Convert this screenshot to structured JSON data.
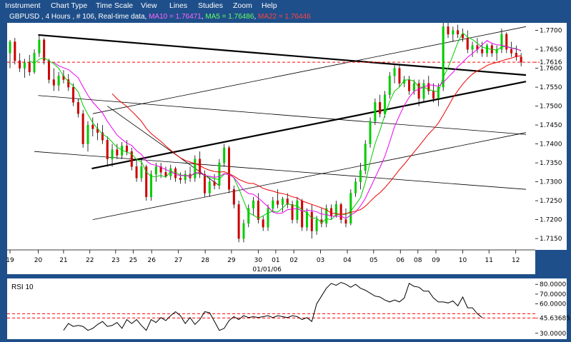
{
  "menu": [
    {
      "id": "instrument",
      "label": "Instrument"
    },
    {
      "id": "chart-type",
      "label": "Chart Type"
    },
    {
      "id": "time-scale",
      "label": "Time Scale"
    },
    {
      "id": "view",
      "label": "View"
    },
    {
      "id": "lines",
      "label": "Lines"
    },
    {
      "id": "studies",
      "label": "Studies"
    },
    {
      "id": "zoom",
      "label": "Zoom"
    },
    {
      "id": "help",
      "label": "Help"
    }
  ],
  "header": {
    "symbol_text": "GBPUSD , 4 Hours , # 106, Real-time data",
    "sep1": ", ",
    "ma10_text": "MA10 = 1.76471",
    "sep2": ", ",
    "ma5_text": "MA5 = 1.76486",
    "sep3": ", ",
    "ma22_text": "MA22 = 1.76446"
  },
  "colors": {
    "background": "#ffffff",
    "frame": "#1f4f8a",
    "up_candle": "#00cc00",
    "down_candle": "#cc0000",
    "ma5": "#00cc00",
    "ma10": "#ee00ee",
    "ma22": "#ee0000",
    "level_line": "#ff0000",
    "rsi_line": "#000000",
    "grid": "#999999"
  },
  "chart_data": [
    {
      "type": "candlestick",
      "title": "GBPUSD , 4 Hours , # 106, Real-time data",
      "price_axis": {
        "ylim": [
          1.712,
          1.772
        ],
        "ticks": [
          "1.7700",
          "1.7650",
          "1.7600",
          "1.7550",
          "1.7500",
          "1.7450",
          "1.7400",
          "1.7350",
          "1.7300",
          "1.7250",
          "1.7200",
          "1.7150"
        ],
        "current_price_label": "1.7616",
        "current_price": 1.7616
      },
      "time_axis": {
        "xlim": [
          0,
          106
        ],
        "ticks": [
          {
            "x": 0,
            "label": "19"
          },
          {
            "x": 5.8,
            "label": "20"
          },
          {
            "x": 11,
            "label": "21"
          },
          {
            "x": 16.4,
            "label": "22"
          },
          {
            "x": 21.7,
            "label": "23"
          },
          {
            "x": 25.3,
            "label": "25"
          },
          {
            "x": 29.1,
            "label": "26"
          },
          {
            "x": 34.6,
            "label": "27"
          },
          {
            "x": 40.1,
            "label": "28"
          },
          {
            "x": 45.5,
            "label": "29"
          },
          {
            "x": 51,
            "label": "30"
          },
          {
            "x": 54.6,
            "label": "01"
          },
          {
            "x": 58.3,
            "label": "02"
          },
          {
            "x": 63.8,
            "label": "03"
          },
          {
            "x": 69.3,
            "label": "04"
          },
          {
            "x": 74.7,
            "label": "05"
          },
          {
            "x": 80.2,
            "label": "06"
          },
          {
            "x": 83.8,
            "label": "08"
          },
          {
            "x": 87.5,
            "label": "09"
          },
          {
            "x": 93,
            "label": "10"
          },
          {
            "x": 98.4,
            "label": "11"
          },
          {
            "x": 103.9,
            "label": "12"
          }
        ],
        "sublabel": "01/01/06",
        "sublabel_x": 52.8
      },
      "candles": [
        [
          1.764,
          1.7675,
          1.76,
          1.767
        ],
        [
          1.767,
          1.768,
          1.761,
          1.762
        ],
        [
          1.762,
          1.764,
          1.759,
          1.76
        ],
        [
          1.76,
          1.7625,
          1.7575,
          1.7615
        ],
        [
          1.7615,
          1.7635,
          1.758,
          1.759
        ],
        [
          1.759,
          1.765,
          1.7585,
          1.764
        ],
        [
          1.764,
          1.769,
          1.763,
          1.7675
        ],
        [
          1.7675,
          1.768,
          1.761,
          1.762
        ],
        [
          1.762,
          1.7625,
          1.756,
          1.757
        ],
        [
          1.757,
          1.76,
          1.754,
          1.7555
        ],
        [
          1.7555,
          1.759,
          1.754,
          1.758
        ],
        [
          1.758,
          1.7595,
          1.756,
          1.757
        ],
        [
          1.757,
          1.7585,
          1.754,
          1.755
        ],
        [
          1.755,
          1.756,
          1.75,
          1.751
        ],
        [
          1.751,
          1.752,
          1.747,
          1.748
        ],
        [
          1.748,
          1.749,
          1.739,
          1.74
        ],
        [
          1.74,
          1.746,
          1.738,
          1.745
        ],
        [
          1.745,
          1.747,
          1.742,
          1.744
        ],
        [
          1.744,
          1.7455,
          1.741,
          1.743
        ],
        [
          1.743,
          1.745,
          1.74,
          1.741
        ],
        [
          1.741,
          1.742,
          1.734,
          1.736
        ],
        [
          1.736,
          1.74,
          1.734,
          1.7385
        ],
        [
          1.7385,
          1.74,
          1.736,
          1.737
        ],
        [
          1.737,
          1.7405,
          1.736,
          1.7395
        ],
        [
          1.7395,
          1.741,
          1.737,
          1.738
        ],
        [
          1.738,
          1.739,
          1.733,
          1.734
        ],
        [
          1.734,
          1.736,
          1.73,
          1.731
        ],
        [
          1.731,
          1.736,
          1.73,
          1.734
        ],
        [
          1.734,
          1.7345,
          1.725,
          1.726
        ],
        [
          1.726,
          1.733,
          1.725,
          1.732
        ],
        [
          1.732,
          1.735,
          1.73,
          1.734
        ],
        [
          1.734,
          1.735,
          1.731,
          1.7325
        ],
        [
          1.7325,
          1.734,
          1.731,
          1.7315
        ],
        [
          1.7315,
          1.7345,
          1.7305,
          1.7335
        ],
        [
          1.7335,
          1.734,
          1.73,
          1.731
        ],
        [
          1.731,
          1.7325,
          1.7295,
          1.7305
        ],
        [
          1.7305,
          1.733,
          1.7295,
          1.732
        ],
        [
          1.732,
          1.734,
          1.73,
          1.731
        ],
        [
          1.731,
          1.737,
          1.73,
          1.736
        ],
        [
          1.736,
          1.738,
          1.731,
          1.732
        ],
        [
          1.732,
          1.733,
          1.726,
          1.727
        ],
        [
          1.727,
          1.731,
          1.726,
          1.73
        ],
        [
          1.73,
          1.732,
          1.728,
          1.729
        ],
        [
          1.729,
          1.736,
          1.728,
          1.735
        ],
        [
          1.735,
          1.74,
          1.734,
          1.739
        ],
        [
          1.739,
          1.7395,
          1.727,
          1.728
        ],
        [
          1.728,
          1.729,
          1.723,
          1.724
        ],
        [
          1.724,
          1.725,
          1.714,
          1.715
        ],
        [
          1.715,
          1.72,
          1.714,
          1.719
        ],
        [
          1.719,
          1.724,
          1.718,
          1.723
        ],
        [
          1.723,
          1.726,
          1.721,
          1.725
        ],
        [
          1.725,
          1.727,
          1.719,
          1.72
        ],
        [
          1.72,
          1.721,
          1.717,
          1.718
        ],
        [
          1.718,
          1.724,
          1.717,
          1.723
        ],
        [
          1.723,
          1.726,
          1.722,
          1.725
        ],
        [
          1.725,
          1.728,
          1.723,
          1.724
        ],
        [
          1.724,
          1.726,
          1.722,
          1.7255
        ],
        [
          1.7255,
          1.727,
          1.723,
          1.724
        ],
        [
          1.724,
          1.725,
          1.719,
          1.72
        ],
        [
          1.72,
          1.726,
          1.719,
          1.725
        ],
        [
          1.725,
          1.7255,
          1.717,
          1.718
        ],
        [
          1.718,
          1.723,
          1.717,
          1.722
        ],
        [
          1.722,
          1.724,
          1.715,
          1.717
        ],
        [
          1.717,
          1.721,
          1.716,
          1.72
        ],
        [
          1.72,
          1.723,
          1.718,
          1.719
        ],
        [
          1.719,
          1.724,
          1.718,
          1.723
        ],
        [
          1.723,
          1.724,
          1.72,
          1.721
        ],
        [
          1.721,
          1.725,
          1.7205,
          1.724
        ],
        [
          1.724,
          1.7245,
          1.719,
          1.72
        ],
        [
          1.72,
          1.723,
          1.718,
          1.719
        ],
        [
          1.719,
          1.728,
          1.7185,
          1.727
        ],
        [
          1.727,
          1.731,
          1.726,
          1.73
        ],
        [
          1.73,
          1.735,
          1.728,
          1.733
        ],
        [
          1.733,
          1.741,
          1.732,
          1.74
        ],
        [
          1.74,
          1.747,
          1.739,
          1.746
        ],
        [
          1.746,
          1.752,
          1.745,
          1.751
        ],
        [
          1.751,
          1.753,
          1.747,
          1.748
        ],
        [
          1.748,
          1.754,
          1.747,
          1.753
        ],
        [
          1.753,
          1.759,
          1.752,
          1.758
        ],
        [
          1.758,
          1.761,
          1.756,
          1.76
        ],
        [
          1.76,
          1.761,
          1.755,
          1.756
        ],
        [
          1.756,
          1.758,
          1.755,
          1.757
        ],
        [
          1.757,
          1.758,
          1.753,
          1.754
        ],
        [
          1.754,
          1.757,
          1.753,
          1.756
        ],
        [
          1.756,
          1.757,
          1.75,
          1.752
        ],
        [
          1.752,
          1.757,
          1.751,
          1.756
        ],
        [
          1.756,
          1.758,
          1.753,
          1.754
        ],
        [
          1.754,
          1.756,
          1.751,
          1.752
        ],
        [
          1.752,
          1.756,
          1.75,
          1.755
        ],
        [
          1.755,
          1.772,
          1.754,
          1.771
        ],
        [
          1.771,
          1.772,
          1.768,
          1.769
        ],
        [
          1.769,
          1.771,
          1.767,
          1.77
        ],
        [
          1.77,
          1.7715,
          1.768,
          1.769
        ],
        [
          1.769,
          1.7705,
          1.767,
          1.768
        ],
        [
          1.768,
          1.77,
          1.764,
          1.765
        ],
        [
          1.765,
          1.767,
          1.763,
          1.766
        ],
        [
          1.766,
          1.768,
          1.764,
          1.765
        ],
        [
          1.765,
          1.767,
          1.763,
          1.764
        ],
        [
          1.764,
          1.7665,
          1.763,
          1.766
        ],
        [
          1.766,
          1.7665,
          1.763,
          1.764
        ],
        [
          1.764,
          1.766,
          1.762,
          1.765
        ],
        [
          1.765,
          1.7705,
          1.764,
          1.769
        ],
        [
          1.769,
          1.7695,
          1.764,
          1.765
        ],
        [
          1.765,
          1.767,
          1.763,
          1.764
        ],
        [
          1.764,
          1.766,
          1.762,
          1.763
        ],
        [
          1.763,
          1.764,
          1.7605,
          1.7616
        ]
      ],
      "series": [
        {
          "name": "MA5",
          "color": "#00cc00",
          "period": 5
        },
        {
          "name": "MA10",
          "color": "#ee00ee",
          "period": 10
        },
        {
          "name": "MA22",
          "color": "#ee0000",
          "period": 22
        }
      ],
      "horizontal_levels": [
        1.7616
      ],
      "trendlines": [
        {
          "from": [
            5.8,
            1.7688
          ],
          "to": [
            106,
            1.7582
          ],
          "weight": "thick"
        },
        {
          "from": [
            16.8,
            1.7335
          ],
          "to": [
            106,
            1.7565
          ],
          "weight": "thick"
        },
        {
          "from": [
            17,
            1.748
          ],
          "to": [
            106,
            1.771
          ],
          "weight": "thin"
        },
        {
          "from": [
            5.8,
            1.7528
          ],
          "to": [
            106,
            1.7425
          ],
          "weight": "thin"
        },
        {
          "from": [
            5,
            1.738
          ],
          "to": [
            106,
            1.728
          ],
          "weight": "thin"
        },
        {
          "from": [
            17,
            1.72
          ],
          "to": [
            106,
            1.743
          ],
          "weight": "thin"
        },
        {
          "from": [
            20,
            1.75
          ],
          "to": [
            43,
            1.729
          ],
          "weight": "thin"
        }
      ]
    },
    {
      "type": "line",
      "title": "RSI 10",
      "ylim": [
        24,
        86
      ],
      "ticks": [
        "80.0000",
        "70.0000",
        "60.0000",
        "45.63685",
        "30.0000"
      ],
      "levels": [
        {
          "value": 50,
          "color": "#ff0000",
          "dashed": true
        },
        {
          "value": 45.63685,
          "color": "#ff0000",
          "dashed": true
        }
      ],
      "current_value": 45.63685,
      "values": [
        [
          11,
          33
        ],
        [
          12,
          40
        ],
        [
          13,
          37
        ],
        [
          14,
          38
        ],
        [
          15,
          37
        ],
        [
          16,
          33
        ],
        [
          17,
          35
        ],
        [
          18,
          39
        ],
        [
          19,
          42
        ],
        [
          20,
          37
        ],
        [
          21,
          38
        ],
        [
          22,
          41
        ],
        [
          23,
          35
        ],
        [
          24,
          44
        ],
        [
          25,
          40
        ],
        [
          26,
          44
        ],
        [
          27,
          38
        ],
        [
          28,
          33
        ],
        [
          29,
          44
        ],
        [
          30,
          41
        ],
        [
          31,
          46
        ],
        [
          32,
          43
        ],
        [
          33,
          48
        ],
        [
          34,
          52
        ],
        [
          35,
          48
        ],
        [
          36,
          40
        ],
        [
          37,
          46
        ],
        [
          38,
          39
        ],
        [
          39,
          44
        ],
        [
          40,
          52
        ],
        [
          41,
          51
        ],
        [
          42,
          42
        ],
        [
          43,
          33
        ],
        [
          44,
          35
        ],
        [
          45,
          43
        ],
        [
          46,
          47
        ],
        [
          47,
          44
        ],
        [
          48,
          48
        ],
        [
          49,
          46
        ],
        [
          50,
          47
        ],
        [
          51,
          46
        ],
        [
          52,
          47
        ],
        [
          53,
          48
        ],
        [
          54,
          46
        ],
        [
          55,
          48
        ],
        [
          56,
          47
        ],
        [
          57,
          46
        ],
        [
          58,
          48
        ],
        [
          59,
          47
        ],
        [
          60,
          44
        ],
        [
          61,
          46
        ],
        [
          62,
          42
        ],
        [
          63,
          60
        ],
        [
          64,
          68
        ],
        [
          65,
          76
        ],
        [
          66,
          81
        ],
        [
          67,
          79
        ],
        [
          68,
          82
        ],
        [
          69,
          80
        ],
        [
          70,
          77
        ],
        [
          71,
          80
        ],
        [
          72,
          76
        ],
        [
          73,
          74
        ],
        [
          74,
          71
        ],
        [
          75,
          68
        ],
        [
          76,
          67
        ],
        [
          77,
          64
        ],
        [
          78,
          62
        ],
        [
          79,
          64
        ],
        [
          80,
          62
        ],
        [
          81,
          66
        ],
        [
          82,
          81
        ],
        [
          83,
          78
        ],
        [
          84,
          77
        ],
        [
          85,
          73
        ],
        [
          86,
          73
        ],
        [
          87,
          66
        ],
        [
          88,
          62
        ],
        [
          89,
          62
        ],
        [
          90,
          61
        ],
        [
          91,
          63
        ],
        [
          92,
          58
        ],
        [
          93,
          67
        ],
        [
          94,
          56
        ],
        [
          95,
          56
        ],
        [
          96,
          50
        ],
        [
          97,
          46
        ]
      ]
    }
  ]
}
